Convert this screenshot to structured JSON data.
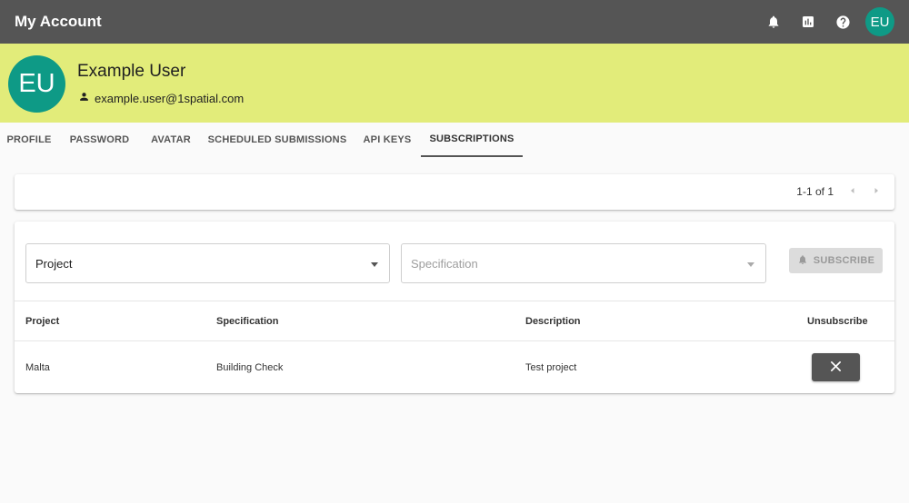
{
  "app": {
    "title": "My Account",
    "avatar_initials": "EU"
  },
  "topbar": {
    "icons": [
      "bell-icon",
      "chart-icon",
      "help-icon"
    ]
  },
  "profile": {
    "initials": "EU",
    "name": "Example User",
    "email": "example.user@1spatial.com"
  },
  "tabs": [
    {
      "label": "PROFILE",
      "active": false
    },
    {
      "label": "PASSWORD",
      "active": false
    },
    {
      "label": "AVATAR",
      "active": false
    },
    {
      "label": "SCHEDULED SUBMISSIONS",
      "active": false
    },
    {
      "label": "API KEYS",
      "active": false
    },
    {
      "label": "SUBSCRIPTIONS",
      "active": true
    }
  ],
  "pager": {
    "range_text": "1-1 of 1"
  },
  "filters": {
    "project_label": "Project",
    "specification_label": "Specification",
    "subscribe_label": "SUBSCRIBE"
  },
  "table": {
    "columns": [
      "Project",
      "Specification",
      "Description",
      "Unsubscribe"
    ],
    "rows": [
      {
        "project": "Malta",
        "specification": "Building Check",
        "description": "Test project"
      }
    ]
  },
  "colors": {
    "topbar": "#555555",
    "banner": "#e2ec7a",
    "avatar": "#0e9a86",
    "unsubscribe_button": "#555555"
  }
}
